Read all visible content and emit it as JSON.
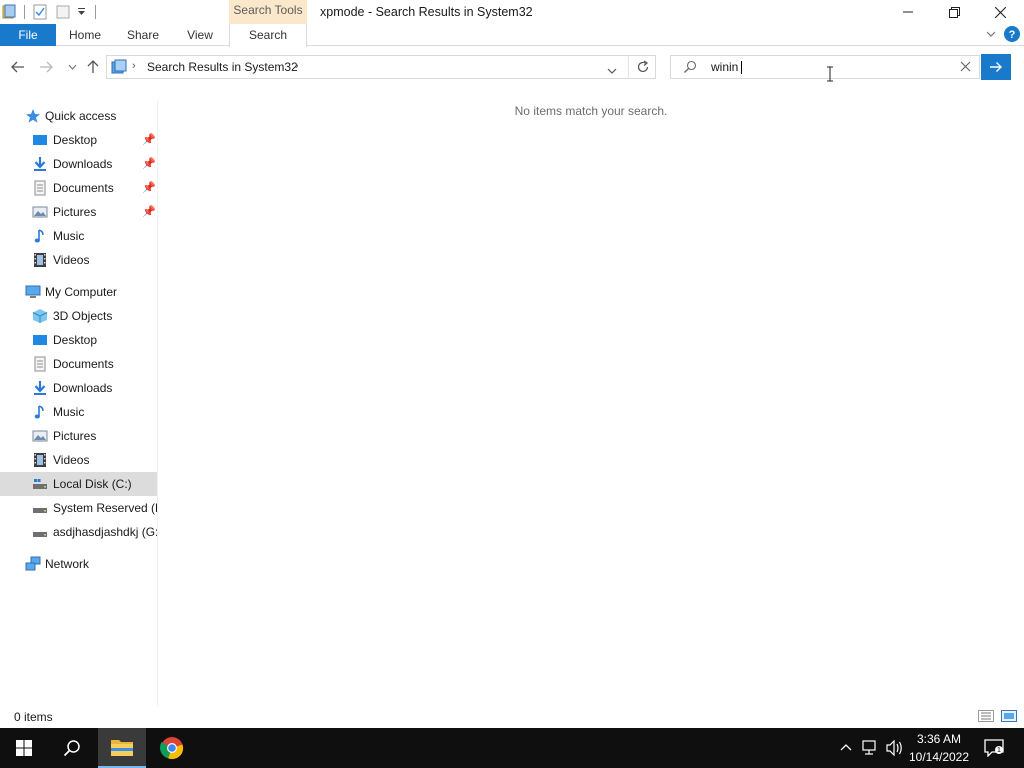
{
  "window": {
    "title": "xpmode - Search Results in System32",
    "context_tab_group": "Search Tools"
  },
  "ribbon": {
    "tabs": [
      "File",
      "Home",
      "Share",
      "View",
      "Search"
    ],
    "active_tab": "Search"
  },
  "address_bar": {
    "path": "Search Results in System32"
  },
  "search": {
    "value": "winin"
  },
  "content": {
    "empty_message": "No items match your search."
  },
  "nav_pane": {
    "quick_access": {
      "label": "Quick access",
      "items": [
        {
          "label": "Desktop",
          "icon": "desktop-icon",
          "pinned": true
        },
        {
          "label": "Downloads",
          "icon": "downloads-icon",
          "pinned": true
        },
        {
          "label": "Documents",
          "icon": "documents-icon",
          "pinned": true
        },
        {
          "label": "Pictures",
          "icon": "pictures-icon",
          "pinned": true
        },
        {
          "label": "Music",
          "icon": "music-icon",
          "pinned": false
        },
        {
          "label": "Videos",
          "icon": "videos-icon",
          "pinned": false
        }
      ]
    },
    "this_pc": {
      "label": "My Computer",
      "items": [
        {
          "label": "3D Objects",
          "icon": "3d-objects-icon"
        },
        {
          "label": "Desktop",
          "icon": "desktop-icon"
        },
        {
          "label": "Documents",
          "icon": "documents-icon"
        },
        {
          "label": "Downloads",
          "icon": "downloads-icon"
        },
        {
          "label": "Music",
          "icon": "music-icon"
        },
        {
          "label": "Pictures",
          "icon": "pictures-icon"
        },
        {
          "label": "Videos",
          "icon": "videos-icon"
        },
        {
          "label": "Local Disk (C:)",
          "icon": "drive-icon",
          "selected": true
        },
        {
          "label": "System Reserved (E:",
          "icon": "drive-icon"
        },
        {
          "label": "asdjhasdjashdkj (G:)",
          "icon": "drive-icon"
        }
      ]
    },
    "network": {
      "label": "Network"
    }
  },
  "status_bar": {
    "item_count": "0 items"
  },
  "taskbar": {
    "time": "3:36 AM",
    "date": "10/14/2022"
  },
  "colors": {
    "accent": "#1979ca",
    "context_tab": "#fbe7c9",
    "selected_item": "#dcdcdc",
    "taskbar": "#0f0f0f"
  }
}
